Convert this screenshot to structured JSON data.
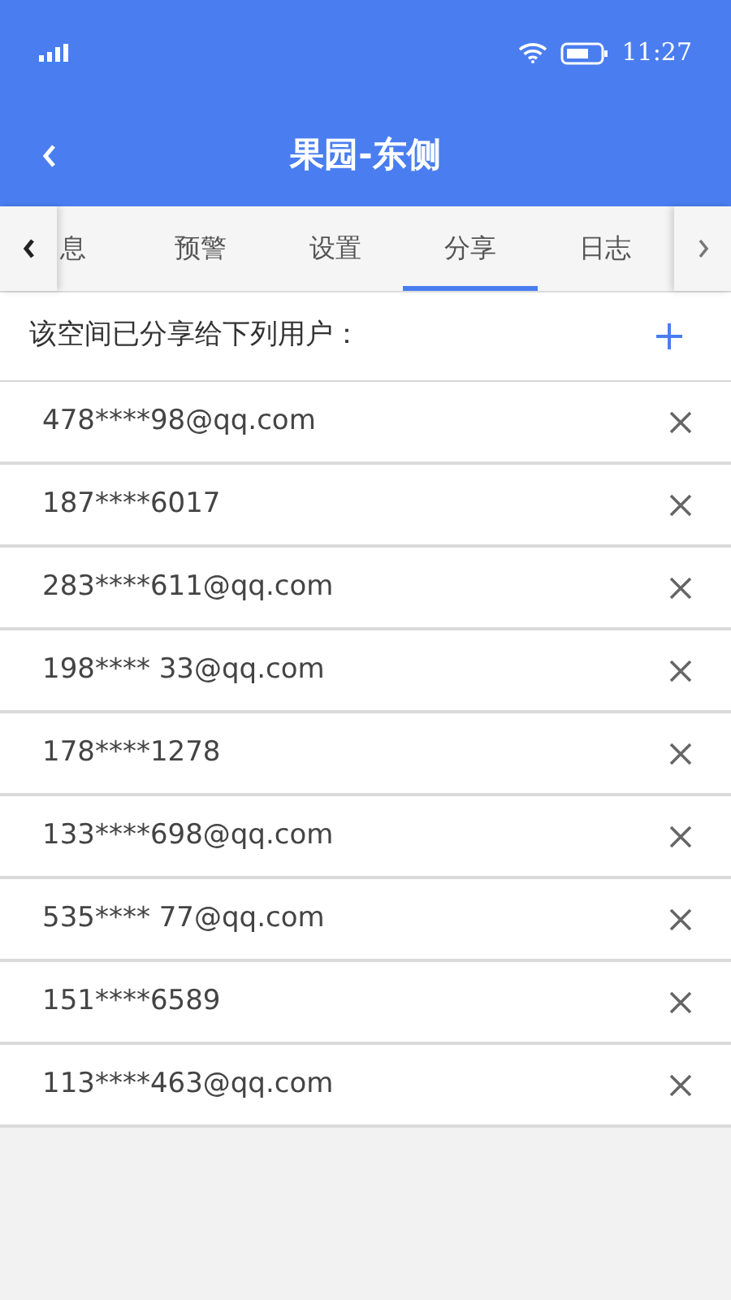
{
  "status_bar": {
    "time": "11:27"
  },
  "header": {
    "title": "果园-东侧"
  },
  "tabs": [
    {
      "label": "息",
      "selected": false
    },
    {
      "label": "预警",
      "selected": false
    },
    {
      "label": "设置",
      "selected": false
    },
    {
      "label": "分享",
      "selected": true
    },
    {
      "label": "日志",
      "selected": false
    }
  ],
  "share_header": {
    "text": "该空间已分享给下列用户："
  },
  "users": [
    {
      "account": "478****98@qq.com"
    },
    {
      "account": "187****6017"
    },
    {
      "account": "283****611@qq.com"
    },
    {
      "account": "198**** 33@qq.com"
    },
    {
      "account": "178****1278"
    },
    {
      "account": "133****698@qq.com"
    },
    {
      "account": "535**** 77@qq.com"
    },
    {
      "account": "151****6589"
    },
    {
      "account": "113****463@qq.com"
    }
  ]
}
